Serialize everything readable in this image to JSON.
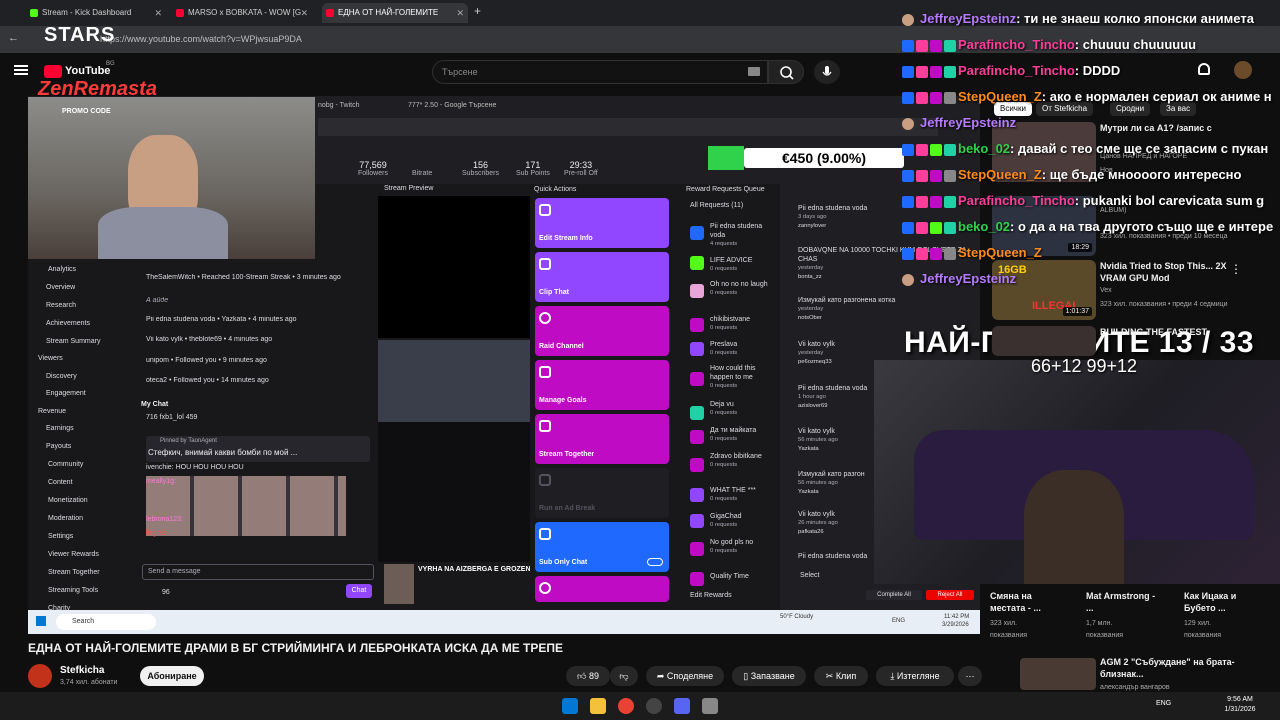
{
  "browser": {
    "tabs": [
      {
        "label": "Stream - Kick Dashboard",
        "color": "#53fc18"
      },
      {
        "label": "MARSO x BOBKATA - WOW [G",
        "color": "#ff0033"
      },
      {
        "label": "ЕДНА ОТ НАЙ-ГОЛЕМИТЕ",
        "color": "#ff0033"
      }
    ],
    "url": "https://www.youtube.com/watch?v=WPjwsuaP9DA"
  },
  "header": {
    "brand": "YouTube",
    "country": "BG",
    "search_placeholder": "Търсене"
  },
  "overlay": {
    "stars_logo": "STARS",
    "zen_logo": "ZenRemasta",
    "promo": "PROMO CODE",
    "money": "€450 (9.00%)",
    "counter": "НАЙ-ГОЛЕМИТЕ 13 / 33",
    "counter_sub": "66+12 99+12",
    "chat": [
      {
        "name": "JeffreyEpsteinz",
        "msg": ": ти не знаеш колко японски анимета"
      },
      {
        "name": "Parafincho_Tincho",
        "msg": ": chuuuu chuuuuuu"
      },
      {
        "name": "Parafincho_Tincho",
        "msg": ": DDDD"
      },
      {
        "name": "StepQueen_Z",
        "msg": ": ако е нормален сериал ок аниме н"
      },
      {
        "name": "JeffreyEpsteinz",
        "msg": ""
      },
      {
        "name": "beko_02",
        "msg": ": давай с тео сме ще се запасим с пукан"
      },
      {
        "name": "StepQueen_Z",
        "msg": ": ще бъде мноооого интересно"
      },
      {
        "name": "Parafincho_Tincho",
        "msg": ": pukanki bol carevicata sum g"
      },
      {
        "name": "beko_02",
        "msg": ": о да а на тва другото също ще е интере"
      },
      {
        "name": "StepQueen_Z",
        "msg": ""
      },
      {
        "name": "JeffreyEpsteinz",
        "msg": ""
      }
    ]
  },
  "dashboard": {
    "stats": [
      {
        "value": "77,569",
        "label": "Followers"
      },
      {
        "value": "",
        "label": "Bitrate"
      },
      {
        "value": "156",
        "label": "Subscribers"
      },
      {
        "value": "171",
        "label": "Sub Points"
      },
      {
        "value": "29:33",
        "label": "Pre-roll Off"
      }
    ],
    "inner_tabs": [
      "nobg - Twitch",
      "777* 2.50 - Google Търсене"
    ],
    "nav": [
      "Analytics",
      "Overview",
      "Research",
      "Achievements",
      "Stream Summary",
      "Viewers",
      "Discovery",
      "Engagement",
      "Revenue",
      "Earnings",
      "Payouts",
      "Community",
      "Content",
      "Monetization",
      "Moderation",
      "Settings",
      "Viewer Rewards",
      "Stream Together",
      "Streaming Tools",
      "Charity"
    ],
    "feed": [
      "TheSalemWitch • Reached 100-Stream Streak • 3 minutes ago",
      "А айде",
      "Pii edna studena voda • Yazkata • 4 minutes ago",
      "Vii kato vylk • theblote69 • 4 minutes ago",
      "unipom • Followed you • 9 minutes ago",
      "oteca2 • Followed you • 14 minutes ago"
    ],
    "mychat": {
      "title": "My Chat",
      "top": "716   fxb1_lol   459",
      "pinned_by": "Pinned by TaonAgent",
      "pinned": "Стефкич, внимай какви бомби по мой ...",
      "line1": "ivenchie: HOU HOU HOU HOU",
      "names": [
        "meally1g:",
        "lebrona123:",
        "llsgreb:"
      ],
      "placeholder": "Send a message",
      "count": "96",
      "chat_btn": "Chat"
    },
    "preview_title": "Stream Preview",
    "preview_caption": "VYRHA NA AIZBERGA E GROZEN",
    "quick_actions_title": "Quick Actions",
    "quick_actions": [
      {
        "label": "Edit Stream Info",
        "color": "#9147ff"
      },
      {
        "label": "Clip That",
        "color": "#9147ff"
      },
      {
        "label": "Raid Channel",
        "color": "#bf0bc3"
      },
      {
        "label": "Manage Goals",
        "color": "#bf0bc3"
      },
      {
        "label": "Stream Together",
        "color": "#bf0bc3"
      },
      {
        "label": "Run an Ad Break",
        "color": "#1f1f23"
      },
      {
        "label": "Sub Only Chat",
        "color": "#1f69ff"
      },
      {
        "label": "",
        "color": "#bf0bc3"
      }
    ],
    "rewards_title": "Reward Requests Queue",
    "all_requests": "All Requests (11)",
    "rewards": [
      {
        "name": "Pii edna studena voda",
        "req": "4 requests",
        "color": "#1f69ff"
      },
      {
        "name": "LIFE ADVICE",
        "req": "0 requests",
        "color": "#53fc18"
      },
      {
        "name": "Oh no no no laugh",
        "req": "0 requests",
        "color": "#e9a5d8"
      },
      {
        "name": "chikibistvane",
        "req": "0 requests",
        "color": "#bf0bc3"
      },
      {
        "name": "Preslava",
        "req": "0 requests",
        "color": "#9147ff"
      },
      {
        "name": "How could this happen to me",
        "req": "0 requests",
        "color": "#bf0bc3"
      },
      {
        "name": "Deja vu",
        "req": "0 requests",
        "color": "#1fd1a5"
      },
      {
        "name": "Да ти майката",
        "req": "0 requests",
        "color": "#bf0bc3"
      },
      {
        "name": "Zdravo bibitkane",
        "req": "0 requests",
        "color": "#bf0bc3"
      },
      {
        "name": "WHAT THE ***",
        "req": "0 requests",
        "color": "#9147ff"
      },
      {
        "name": "GigaChad",
        "req": "0 requests",
        "color": "#9147ff"
      },
      {
        "name": "No god pls no",
        "req": "0 requests",
        "color": "#bf0bc3"
      },
      {
        "name": "Quality Time",
        "req": "",
        "color": "#bf0bc3"
      }
    ],
    "edit_rewards": "Edit Rewards",
    "queue": [
      {
        "title": "Pii edna studena voda",
        "time": "3 days ago",
        "user": "zannylover"
      },
      {
        "title": "DOBAVQNE NA 10000 TOCHKI KYM GOLOVETE ZA CHAS",
        "time": "yesterday",
        "user": "bonta_zz"
      },
      {
        "title": "Измукай като разгонена котка",
        "time": "yesterday",
        "user": "notsOber"
      },
      {
        "title": "Vii kato vylk",
        "time": "yesterday",
        "user": "pe6ozmeq33"
      },
      {
        "title": "Pii edna studena voda",
        "time": "1 hour ago",
        "user": "azislover69"
      },
      {
        "title": "Vii kato vylk",
        "time": "56 minutes ago",
        "user": "Yazkata"
      },
      {
        "title": "Измукай като разгон",
        "time": "56 minutes ago",
        "user": "Yazkata"
      },
      {
        "title": "Vii kato vylk",
        "time": "26 minutes ago",
        "user": "pafkata26"
      },
      {
        "title": "Pii edna studena voda",
        "time": "",
        "user": ""
      }
    ],
    "select": "Select",
    "complete_all": "Complete All",
    "reject_all": "Reject All",
    "inner_search": "Search",
    "weather": "50°F Cloudy",
    "inner_lang": "ENG",
    "inner_time": "11:42 PM",
    "inner_date": "3/29/2026"
  },
  "sidebar": {
    "chips": [
      "Всички",
      "От Stefkicha",
      "Сродни",
      "За вас"
    ],
    "videos": [
      {
        "title": "Мутри ли са А1? /запис с",
        "meta1": "Цанов НАПРЕД и НАГОРЕ",
        "meta2": "Нов",
        "duration": ""
      },
      {
        "title": "",
        "meta1": "ALBUM)",
        "meta2": "323 хил. показвания • преди 10 месеца",
        "duration": "18:29"
      },
      {
        "title": "Nvidia Tried to Stop This... 2X VRAM GPU Mod",
        "meta1": "Vex",
        "meta2": "323 хил. показвания • преди 4 седмици",
        "duration": "1:01:37"
      },
      {
        "title": "BUILDING THE FASTEST",
        "meta1": "",
        "meta2": "",
        "duration": ""
      }
    ],
    "bottom": [
      {
        "title": "Смяна на местата - ...",
        "views": "323 хил.",
        "label": "показвания"
      },
      {
        "title": "Mat Armstrong - ...",
        "views": "1,7 млн.",
        "label": "показвания"
      },
      {
        "title": "Как Ицака и Бубето ...",
        "views": "129 хил.",
        "label": "показвания"
      }
    ],
    "last": {
      "title": "AGM 2 \"Събуждане\" на брата- близнак...",
      "meta": "александър вангаров"
    },
    "thumb_labels": [
      "16GB",
      "ILLEGAL"
    ]
  },
  "video": {
    "title": "ЕДНА ОТ НАЙ-ГОЛЕМИТЕ ДРАМИ В БГ СТРИЙМИНГА И ЛЕБРОНКАТА ИСКА ДА МЕ ТРЕПЕ",
    "channel": "Stefkicha",
    "subs": "3,74 хил. абонати",
    "subscribe": "Абониране",
    "likes": "89",
    "share": "Споделяне",
    "save": "Запазване",
    "clip": "Клип",
    "download": "Изтегляне"
  },
  "system": {
    "lang": "ENG",
    "time": "9:56 AM",
    "date": "1/31/2026"
  }
}
